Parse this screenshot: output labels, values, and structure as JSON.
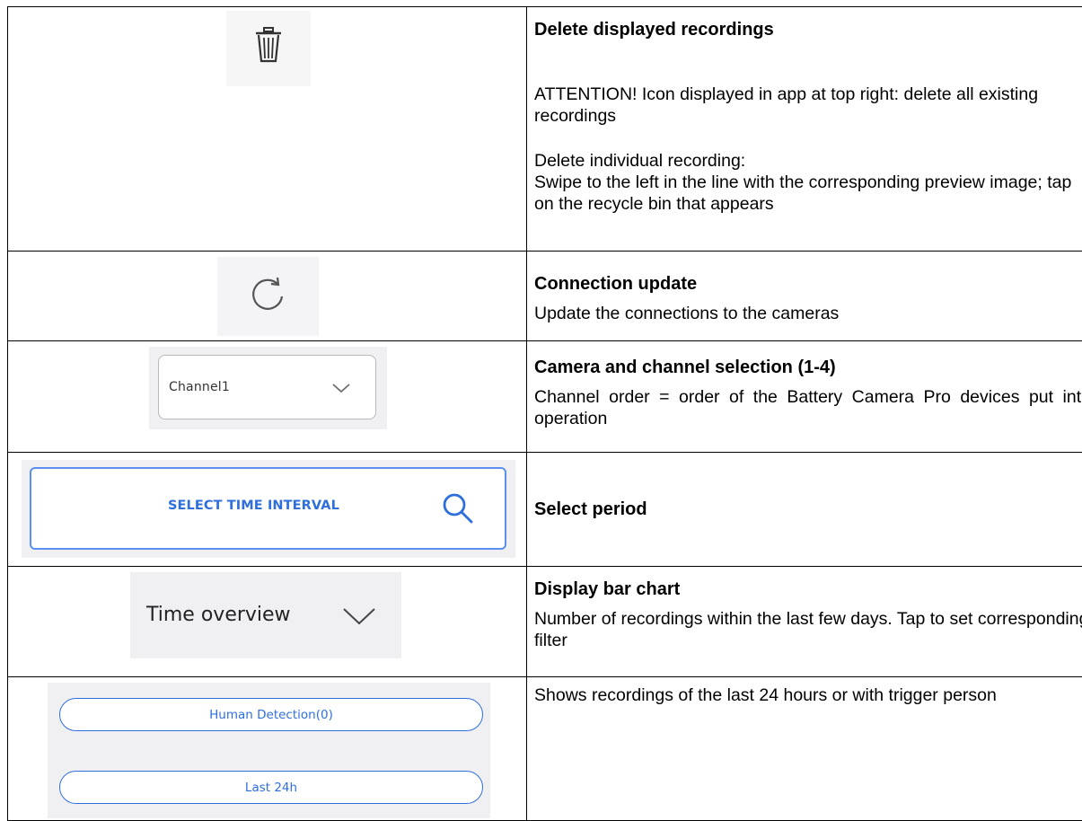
{
  "rows": [
    {
      "icon": "trash-icon",
      "title": "Delete displayed recordings",
      "paragraphs": [
        "ATTENTION! Icon displayed in app at top right: delete all existing recordings",
        "Delete individual recording:",
        "Swipe to the left in the line with the corresponding preview image; tap on the recycle bin that appears"
      ]
    },
    {
      "icon": "refresh-icon",
      "title": "Connection update",
      "paragraphs": [
        "Update the connections to the cameras"
      ]
    },
    {
      "icon": "chevron-down-icon",
      "select_value": "Channel1",
      "title": "Camera and channel selection (1-4)",
      "paragraphs": [
        "Channel order = order of the Battery Camera Pro devices put into operation"
      ]
    },
    {
      "icon": "search-icon",
      "button_label": "SELECT TIME INTERVAL",
      "title": "Select period",
      "paragraphs": []
    },
    {
      "icon": "chevron-down-icon",
      "toggle_label": "Time overview",
      "title": "Display bar chart",
      "paragraphs": [
        "Number of recordings within the last few days. Tap to set corresponding filter"
      ]
    },
    {
      "chips": [
        "Human Detection(0)",
        "Last 24h"
      ],
      "title": "",
      "paragraphs": [
        "Shows recordings of the last 24 hours or with trigger person"
      ]
    }
  ],
  "colors": {
    "accent": "#2f6fdc",
    "tile_bg": "#f0f0f3"
  }
}
